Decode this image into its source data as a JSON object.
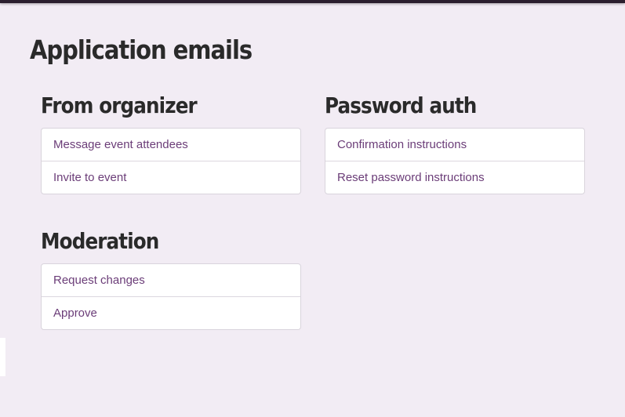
{
  "page": {
    "title": "Application emails"
  },
  "sections": [
    {
      "title": "From organizer",
      "items": [
        "Message event attendees",
        "Invite to event"
      ]
    },
    {
      "title": "Password auth",
      "items": [
        "Confirmation instructions",
        "Reset password instructions"
      ]
    },
    {
      "title": "Moderation",
      "items": [
        "Request changes",
        "Approve"
      ]
    }
  ],
  "colors": {
    "background": "#f2ecf4",
    "link": "#6b3d78",
    "heading": "#2a2a2a",
    "topbar": "#2b1f2e"
  }
}
